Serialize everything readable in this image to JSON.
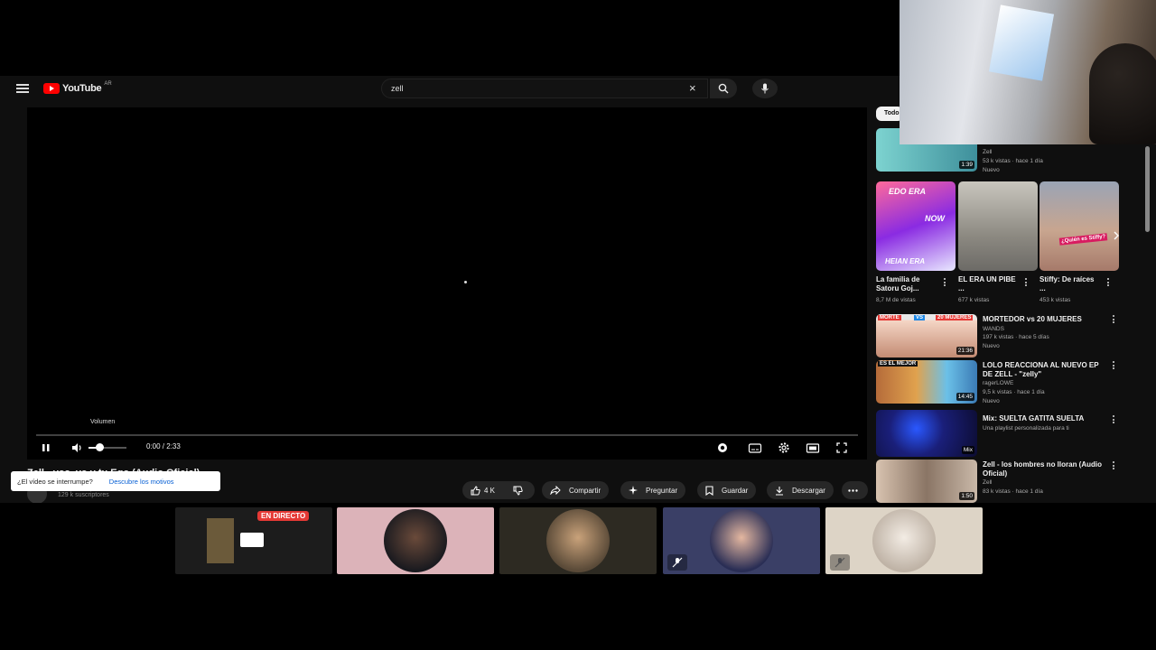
{
  "header": {
    "logo_text": "YouTube",
    "country_code": "AR",
    "search_value": "zell"
  },
  "player": {
    "volume_tooltip": "Volumen",
    "time": "0:00 / 2:33",
    "elapsed_fraction": 0.0,
    "volume_fraction": 0.35
  },
  "video": {
    "title": "Zell - vos, yo y tu Ego (Audio Oficial)",
    "subscribers": "129 k suscriptores",
    "likes": "4 K",
    "share": "Compartir",
    "ask": "Preguntar",
    "save": "Guardar",
    "download": "Descargar"
  },
  "popup": {
    "question": "¿El vídeo se interrumpe?",
    "link": "Descubre los motivos"
  },
  "sidebar": {
    "chip": "Todo",
    "top_item": {
      "channel": "Zell",
      "meta": "53 k vistas · hace 1 día",
      "badge": "Nuevo",
      "duration": "1:39"
    },
    "shorts": [
      {
        "title": "La familia de Satoru Goj...",
        "views": "8,7 M de vistas",
        "thumb_top": "EDO ERA",
        "thumb_mid": "NOW",
        "thumb_bot": "HEIAN ERA"
      },
      {
        "title": "EL ERA UN PIBE ...",
        "views": "677 k vistas"
      },
      {
        "title": "Stiffy: De raíces ...",
        "views": "453 k vistas",
        "thumb_label": "¿Quién es Stiffy?"
      }
    ],
    "videos": [
      {
        "title": "MORTEDOR vs 20 MUJERES",
        "channel": "WANDS",
        "meta": "197 k vistas · hace 5 días",
        "badge": "Nuevo",
        "duration": "21:36",
        "banner_left": "MORTE",
        "banner_mid": "VS",
        "banner_right": "20 MUJERES"
      },
      {
        "title": "LOLO REACCIONA AL NUEVO EP DE ZELL - \"zelly\"",
        "channel": "ragerLOWE",
        "meta": "9,5 k vistas · hace 1 día",
        "badge": "Nuevo",
        "duration": "14:45",
        "banner_left": "ES EL MEJOR"
      },
      {
        "title": "Mix: SUELTA GATITA SUELTA",
        "channel": "Una playlist personalizada para ti",
        "meta": "",
        "badge": "",
        "duration": "Mix"
      },
      {
        "title": "Zell - los hombres no lloran (Audio Oficial)",
        "channel": "Zell",
        "meta": "83 k vistas · hace 1 día",
        "badge": "",
        "duration": "1:50"
      }
    ]
  },
  "participants": {
    "live_label": "EN DIRECTO"
  },
  "colors": {
    "brand_red": "#ff0000",
    "live_red": "#e53935",
    "link_blue": "#065fd4"
  }
}
